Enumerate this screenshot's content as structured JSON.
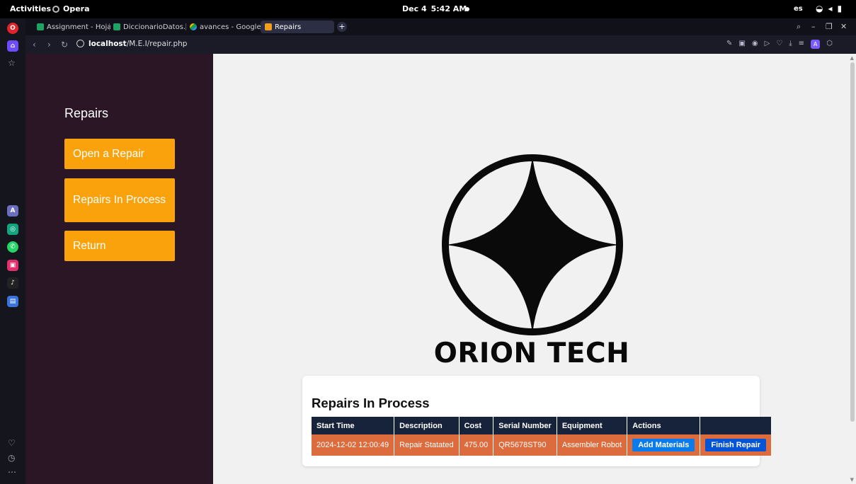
{
  "os_bar": {
    "activities": "Activities",
    "app_name": "Opera",
    "date": "Dec 4",
    "time": "5:42 AM",
    "language": "es"
  },
  "tabs": [
    {
      "label": "Assignment - Hojas",
      "favicon": "sheets-icon"
    },
    {
      "label": "DiccionarioDatos.xls",
      "favicon": "sheets-icon"
    },
    {
      "label": "avances - Google Dri",
      "favicon": "drive-icon"
    },
    {
      "label": "Repairs",
      "favicon": "repairs-favicon",
      "active": true
    }
  ],
  "address_bar": {
    "host": "localhost",
    "path": "/M.E.I/repair.php"
  },
  "sidebar": {
    "heading": "Repairs",
    "buttons": [
      {
        "label": "Open a Repair"
      },
      {
        "label": "Repairs In Process"
      },
      {
        "label": "Return"
      }
    ]
  },
  "brand": {
    "name": "ORION TECH"
  },
  "repairs_table": {
    "title": "Repairs In Process",
    "columns": [
      "Start Time",
      "Description",
      "Cost",
      "Serial Number",
      "Equipment",
      "Actions",
      ""
    ],
    "rows": [
      {
        "start_time": "2024-12-02 12:00:49",
        "description": "Repair Statated",
        "cost": "475.00",
        "serial_number": "QR5678ST90",
        "equipment": "Assembler Robot",
        "add_materials": "Add Materials",
        "finish_repair": "Finish Repair"
      }
    ]
  },
  "colors": {
    "sidebar_bg": "#2a1624",
    "button_orange": "#f9a20b",
    "table_header": "#17233a",
    "table_row": "#dc6b3d",
    "action_blue": "#0a7bea"
  }
}
